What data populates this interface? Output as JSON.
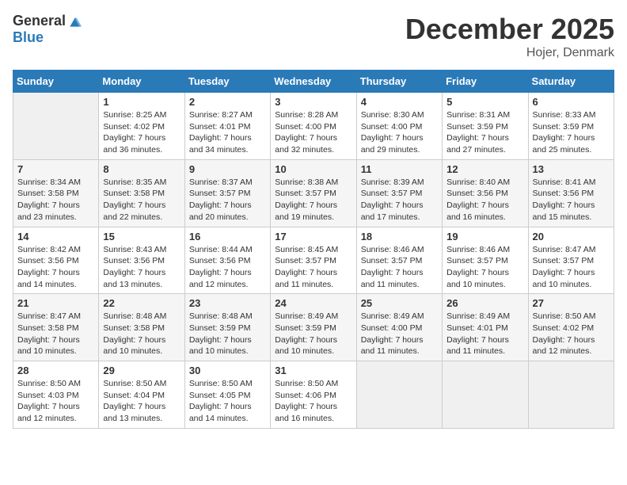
{
  "header": {
    "logo_general": "General",
    "logo_blue": "Blue",
    "month": "December 2025",
    "location": "Hojer, Denmark"
  },
  "days_of_week": [
    "Sunday",
    "Monday",
    "Tuesday",
    "Wednesday",
    "Thursday",
    "Friday",
    "Saturday"
  ],
  "weeks": [
    [
      {
        "day": "",
        "empty": true
      },
      {
        "day": "1",
        "sunrise": "Sunrise: 8:25 AM",
        "sunset": "Sunset: 4:02 PM",
        "daylight": "Daylight: 7 hours and 36 minutes."
      },
      {
        "day": "2",
        "sunrise": "Sunrise: 8:27 AM",
        "sunset": "Sunset: 4:01 PM",
        "daylight": "Daylight: 7 hours and 34 minutes."
      },
      {
        "day": "3",
        "sunrise": "Sunrise: 8:28 AM",
        "sunset": "Sunset: 4:00 PM",
        "daylight": "Daylight: 7 hours and 32 minutes."
      },
      {
        "day": "4",
        "sunrise": "Sunrise: 8:30 AM",
        "sunset": "Sunset: 4:00 PM",
        "daylight": "Daylight: 7 hours and 29 minutes."
      },
      {
        "day": "5",
        "sunrise": "Sunrise: 8:31 AM",
        "sunset": "Sunset: 3:59 PM",
        "daylight": "Daylight: 7 hours and 27 minutes."
      },
      {
        "day": "6",
        "sunrise": "Sunrise: 8:33 AM",
        "sunset": "Sunset: 3:59 PM",
        "daylight": "Daylight: 7 hours and 25 minutes."
      }
    ],
    [
      {
        "day": "7",
        "sunrise": "Sunrise: 8:34 AM",
        "sunset": "Sunset: 3:58 PM",
        "daylight": "Daylight: 7 hours and 23 minutes."
      },
      {
        "day": "8",
        "sunrise": "Sunrise: 8:35 AM",
        "sunset": "Sunset: 3:58 PM",
        "daylight": "Daylight: 7 hours and 22 minutes."
      },
      {
        "day": "9",
        "sunrise": "Sunrise: 8:37 AM",
        "sunset": "Sunset: 3:57 PM",
        "daylight": "Daylight: 7 hours and 20 minutes."
      },
      {
        "day": "10",
        "sunrise": "Sunrise: 8:38 AM",
        "sunset": "Sunset: 3:57 PM",
        "daylight": "Daylight: 7 hours and 19 minutes."
      },
      {
        "day": "11",
        "sunrise": "Sunrise: 8:39 AM",
        "sunset": "Sunset: 3:57 PM",
        "daylight": "Daylight: 7 hours and 17 minutes."
      },
      {
        "day": "12",
        "sunrise": "Sunrise: 8:40 AM",
        "sunset": "Sunset: 3:56 PM",
        "daylight": "Daylight: 7 hours and 16 minutes."
      },
      {
        "day": "13",
        "sunrise": "Sunrise: 8:41 AM",
        "sunset": "Sunset: 3:56 PM",
        "daylight": "Daylight: 7 hours and 15 minutes."
      }
    ],
    [
      {
        "day": "14",
        "sunrise": "Sunrise: 8:42 AM",
        "sunset": "Sunset: 3:56 PM",
        "daylight": "Daylight: 7 hours and 14 minutes."
      },
      {
        "day": "15",
        "sunrise": "Sunrise: 8:43 AM",
        "sunset": "Sunset: 3:56 PM",
        "daylight": "Daylight: 7 hours and 13 minutes."
      },
      {
        "day": "16",
        "sunrise": "Sunrise: 8:44 AM",
        "sunset": "Sunset: 3:56 PM",
        "daylight": "Daylight: 7 hours and 12 minutes."
      },
      {
        "day": "17",
        "sunrise": "Sunrise: 8:45 AM",
        "sunset": "Sunset: 3:57 PM",
        "daylight": "Daylight: 7 hours and 11 minutes."
      },
      {
        "day": "18",
        "sunrise": "Sunrise: 8:46 AM",
        "sunset": "Sunset: 3:57 PM",
        "daylight": "Daylight: 7 hours and 11 minutes."
      },
      {
        "day": "19",
        "sunrise": "Sunrise: 8:46 AM",
        "sunset": "Sunset: 3:57 PM",
        "daylight": "Daylight: 7 hours and 10 minutes."
      },
      {
        "day": "20",
        "sunrise": "Sunrise: 8:47 AM",
        "sunset": "Sunset: 3:57 PM",
        "daylight": "Daylight: 7 hours and 10 minutes."
      }
    ],
    [
      {
        "day": "21",
        "sunrise": "Sunrise: 8:47 AM",
        "sunset": "Sunset: 3:58 PM",
        "daylight": "Daylight: 7 hours and 10 minutes."
      },
      {
        "day": "22",
        "sunrise": "Sunrise: 8:48 AM",
        "sunset": "Sunset: 3:58 PM",
        "daylight": "Daylight: 7 hours and 10 minutes."
      },
      {
        "day": "23",
        "sunrise": "Sunrise: 8:48 AM",
        "sunset": "Sunset: 3:59 PM",
        "daylight": "Daylight: 7 hours and 10 minutes."
      },
      {
        "day": "24",
        "sunrise": "Sunrise: 8:49 AM",
        "sunset": "Sunset: 3:59 PM",
        "daylight": "Daylight: 7 hours and 10 minutes."
      },
      {
        "day": "25",
        "sunrise": "Sunrise: 8:49 AM",
        "sunset": "Sunset: 4:00 PM",
        "daylight": "Daylight: 7 hours and 11 minutes."
      },
      {
        "day": "26",
        "sunrise": "Sunrise: 8:49 AM",
        "sunset": "Sunset: 4:01 PM",
        "daylight": "Daylight: 7 hours and 11 minutes."
      },
      {
        "day": "27",
        "sunrise": "Sunrise: 8:50 AM",
        "sunset": "Sunset: 4:02 PM",
        "daylight": "Daylight: 7 hours and 12 minutes."
      }
    ],
    [
      {
        "day": "28",
        "sunrise": "Sunrise: 8:50 AM",
        "sunset": "Sunset: 4:03 PM",
        "daylight": "Daylight: 7 hours and 12 minutes."
      },
      {
        "day": "29",
        "sunrise": "Sunrise: 8:50 AM",
        "sunset": "Sunset: 4:04 PM",
        "daylight": "Daylight: 7 hours and 13 minutes."
      },
      {
        "day": "30",
        "sunrise": "Sunrise: 8:50 AM",
        "sunset": "Sunset: 4:05 PM",
        "daylight": "Daylight: 7 hours and 14 minutes."
      },
      {
        "day": "31",
        "sunrise": "Sunrise: 8:50 AM",
        "sunset": "Sunset: 4:06 PM",
        "daylight": "Daylight: 7 hours and 16 minutes."
      },
      {
        "day": "",
        "empty": true
      },
      {
        "day": "",
        "empty": true
      },
      {
        "day": "",
        "empty": true
      }
    ]
  ]
}
